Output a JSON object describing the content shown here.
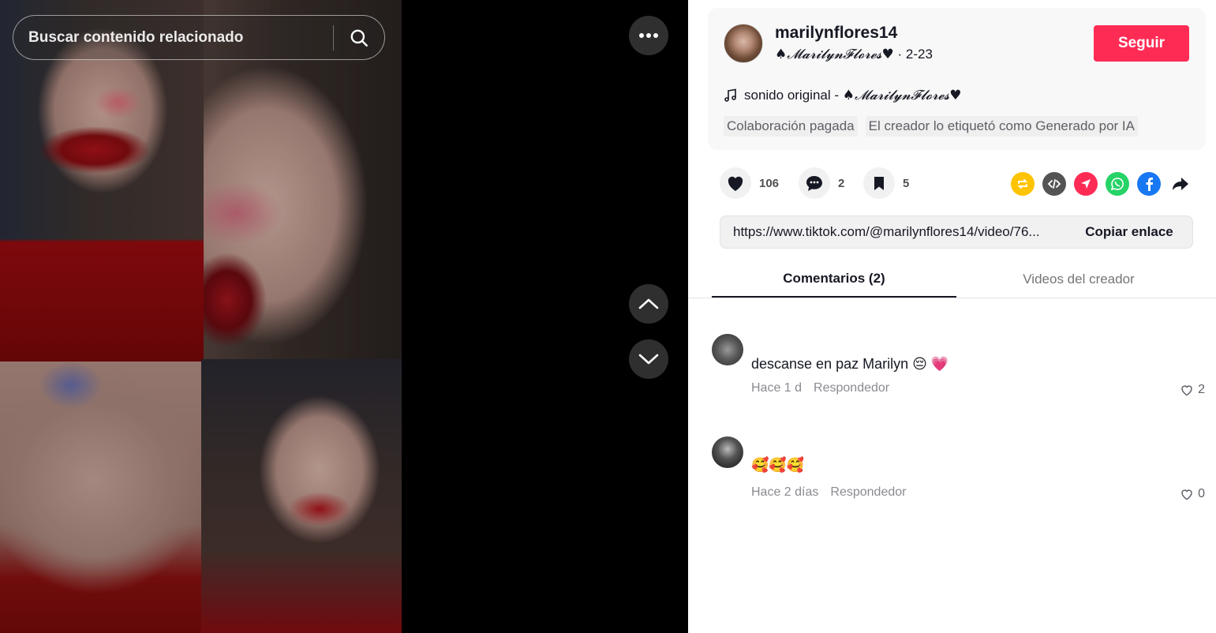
{
  "search": {
    "placeholder": "Buscar contenido relacionado"
  },
  "post": {
    "username": "marilynflores14",
    "display_name": "♠𝓜𝓪𝓻𝓲𝓵𝔂𝓷𝓕𝓵𝓸𝓻𝓮𝓼♥",
    "date": " · 2-23",
    "follow_label": "Seguir",
    "music_prefix": "sonido original - ",
    "music_author": "♠𝓜𝓪𝓻𝓲𝓵𝔂𝓷𝓕𝓵𝓸𝓻𝓮𝓼♥",
    "tags": [
      "Colaboración pagada",
      "El creador lo etiquetó como Generado por IA"
    ]
  },
  "actions": {
    "likes": "106",
    "comments": "2",
    "saves": "5",
    "share_icons": [
      "repost-icon",
      "embed-icon",
      "send-icon",
      "whatsapp-icon",
      "facebook-icon",
      "share-arrow-icon"
    ]
  },
  "link": {
    "url": "https://www.tiktok.com/@marilynflores14/video/76...",
    "copy_label": "Copiar enlace"
  },
  "tabs": {
    "comments": "Comentarios (2)",
    "creator_videos": "Videos del creador"
  },
  "comments": [
    {
      "text": "descanse en paz Marilyn 😔 💗",
      "time": "Hace 1 d",
      "reply": "Respondedor",
      "likes": "2"
    },
    {
      "text": "🥰🥰🥰",
      "time": "Hace 2 días",
      "reply": "Respondedor",
      "likes": "0"
    }
  ],
  "colors": {
    "accent": "#fe2c55",
    "repost": "#ffc300",
    "embed": "#545454",
    "send": "#fe2c55",
    "whatsapp": "#25d366",
    "facebook": "#1877f2"
  }
}
